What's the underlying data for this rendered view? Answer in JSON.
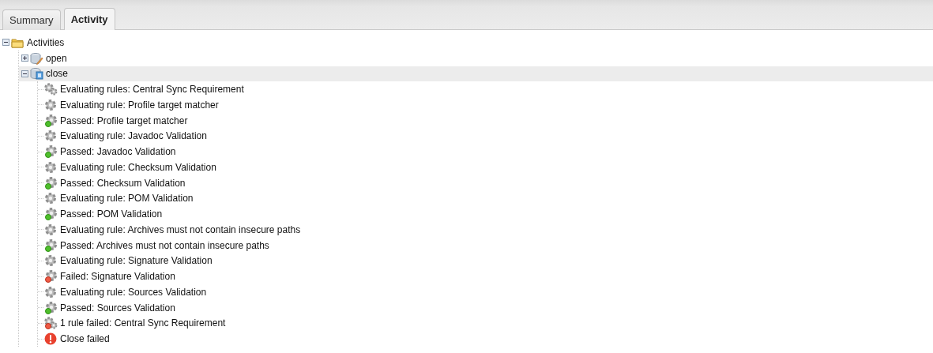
{
  "tabs": [
    {
      "label": "Summary",
      "selected": false
    },
    {
      "label": "Activity",
      "selected": true
    }
  ],
  "tree": {
    "label": "Activities",
    "kind": "folder",
    "expanded": true,
    "selected": false,
    "children": [
      {
        "label": "open",
        "kind": "repo-edit",
        "expanded": false,
        "selected": false
      },
      {
        "label": "close",
        "kind": "repo-close",
        "expanded": true,
        "selected": true,
        "children": [
          {
            "label": "Evaluating rules: Central Sync Requirement",
            "kind": "rules"
          },
          {
            "label": "Evaluating rule: Profile target matcher",
            "kind": "rule"
          },
          {
            "label": "Passed: Profile target matcher",
            "kind": "passed"
          },
          {
            "label": "Evaluating rule: Javadoc Validation",
            "kind": "rule"
          },
          {
            "label": "Passed: Javadoc Validation",
            "kind": "passed"
          },
          {
            "label": "Evaluating rule: Checksum Validation",
            "kind": "rule"
          },
          {
            "label": "Passed: Checksum Validation",
            "kind": "passed"
          },
          {
            "label": "Evaluating rule: POM Validation",
            "kind": "rule"
          },
          {
            "label": "Passed: POM Validation",
            "kind": "passed"
          },
          {
            "label": "Evaluating rule: Archives must not contain insecure paths",
            "kind": "rule"
          },
          {
            "label": "Passed: Archives must not contain insecure paths",
            "kind": "passed"
          },
          {
            "label": "Evaluating rule: Signature Validation",
            "kind": "rule"
          },
          {
            "label": "Failed: Signature Validation",
            "kind": "failed"
          },
          {
            "label": "Evaluating rule: Sources Validation",
            "kind": "rule"
          },
          {
            "label": "Passed: Sources Validation",
            "kind": "passed"
          },
          {
            "label": "1 rule failed: Central Sync Requirement",
            "kind": "rules-failed"
          },
          {
            "label": "Close failed",
            "kind": "error"
          }
        ]
      }
    ]
  }
}
